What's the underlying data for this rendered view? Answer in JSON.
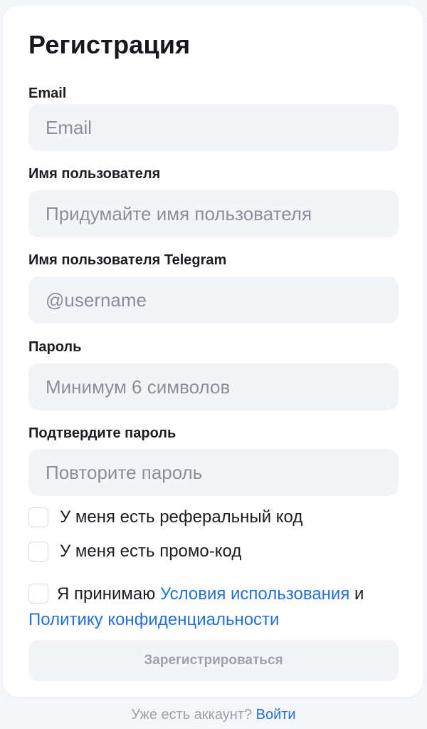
{
  "form": {
    "title": "Регистрация",
    "fields": [
      {
        "label": "Email",
        "placeholder": "Email",
        "value": ""
      },
      {
        "label": "Имя пользователя",
        "placeholder": "Придумайте имя пользователя",
        "value": ""
      },
      {
        "label": "Имя пользователя Telegram",
        "placeholder": "@username",
        "value": ""
      },
      {
        "label": "Пароль",
        "placeholder": "Минимум 6 символов",
        "value": ""
      },
      {
        "label": "Подтвердите пароль",
        "placeholder": "Повторите пароль",
        "value": ""
      }
    ],
    "checkboxes": {
      "referral": {
        "label": "У меня есть реферальный код",
        "checked": false
      },
      "promo": {
        "label": "У меня есть промо-код",
        "checked": false
      },
      "terms": {
        "prefix": "Я принимаю",
        "terms_link": "Условия использования",
        "conjunction": "и",
        "privacy_link": "Политику конфиденциальности",
        "checked": false
      }
    },
    "submit_label": "Зарегистрироваться",
    "submit_disabled": true
  },
  "footer": {
    "text": "Уже есть аккаунт?",
    "login_link": "Войти"
  },
  "colors": {
    "accent": "#2370d6",
    "input_bg": "#f2f4f7",
    "page_bg": "#f4f6fa",
    "disabled_text": "#9ca3ad"
  }
}
